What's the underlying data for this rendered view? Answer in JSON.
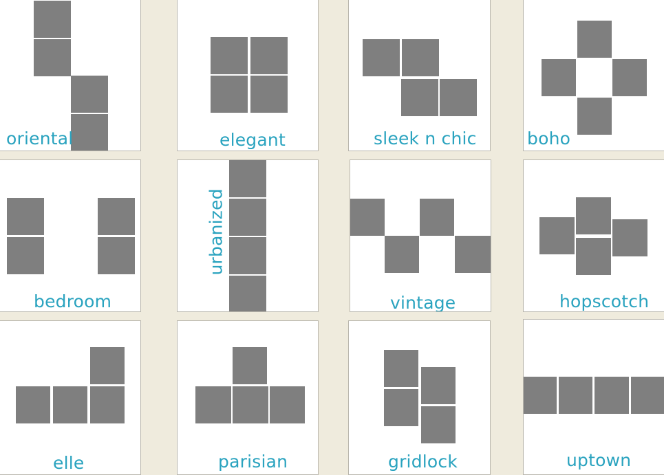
{
  "colors": {
    "background": "#efebdd",
    "card": "#ffffff",
    "tile": "#7f7f7f",
    "label": "#2aa3bf"
  },
  "layouts": [
    {
      "id": "oriental",
      "label": "oriental"
    },
    {
      "id": "elegant",
      "label": "elegant"
    },
    {
      "id": "sleek-n-chic",
      "label": "sleek n chic"
    },
    {
      "id": "boho",
      "label": "boho"
    },
    {
      "id": "bedroom",
      "label": "bedroom"
    },
    {
      "id": "urbanized",
      "label": "urbanized"
    },
    {
      "id": "vintage",
      "label": "vintage"
    },
    {
      "id": "hopscotch",
      "label": "hopscotch"
    },
    {
      "id": "elle",
      "label": "elle"
    },
    {
      "id": "parisian",
      "label": "parisian"
    },
    {
      "id": "gridlock",
      "label": "gridlock"
    },
    {
      "id": "uptown",
      "label": "uptown"
    }
  ]
}
